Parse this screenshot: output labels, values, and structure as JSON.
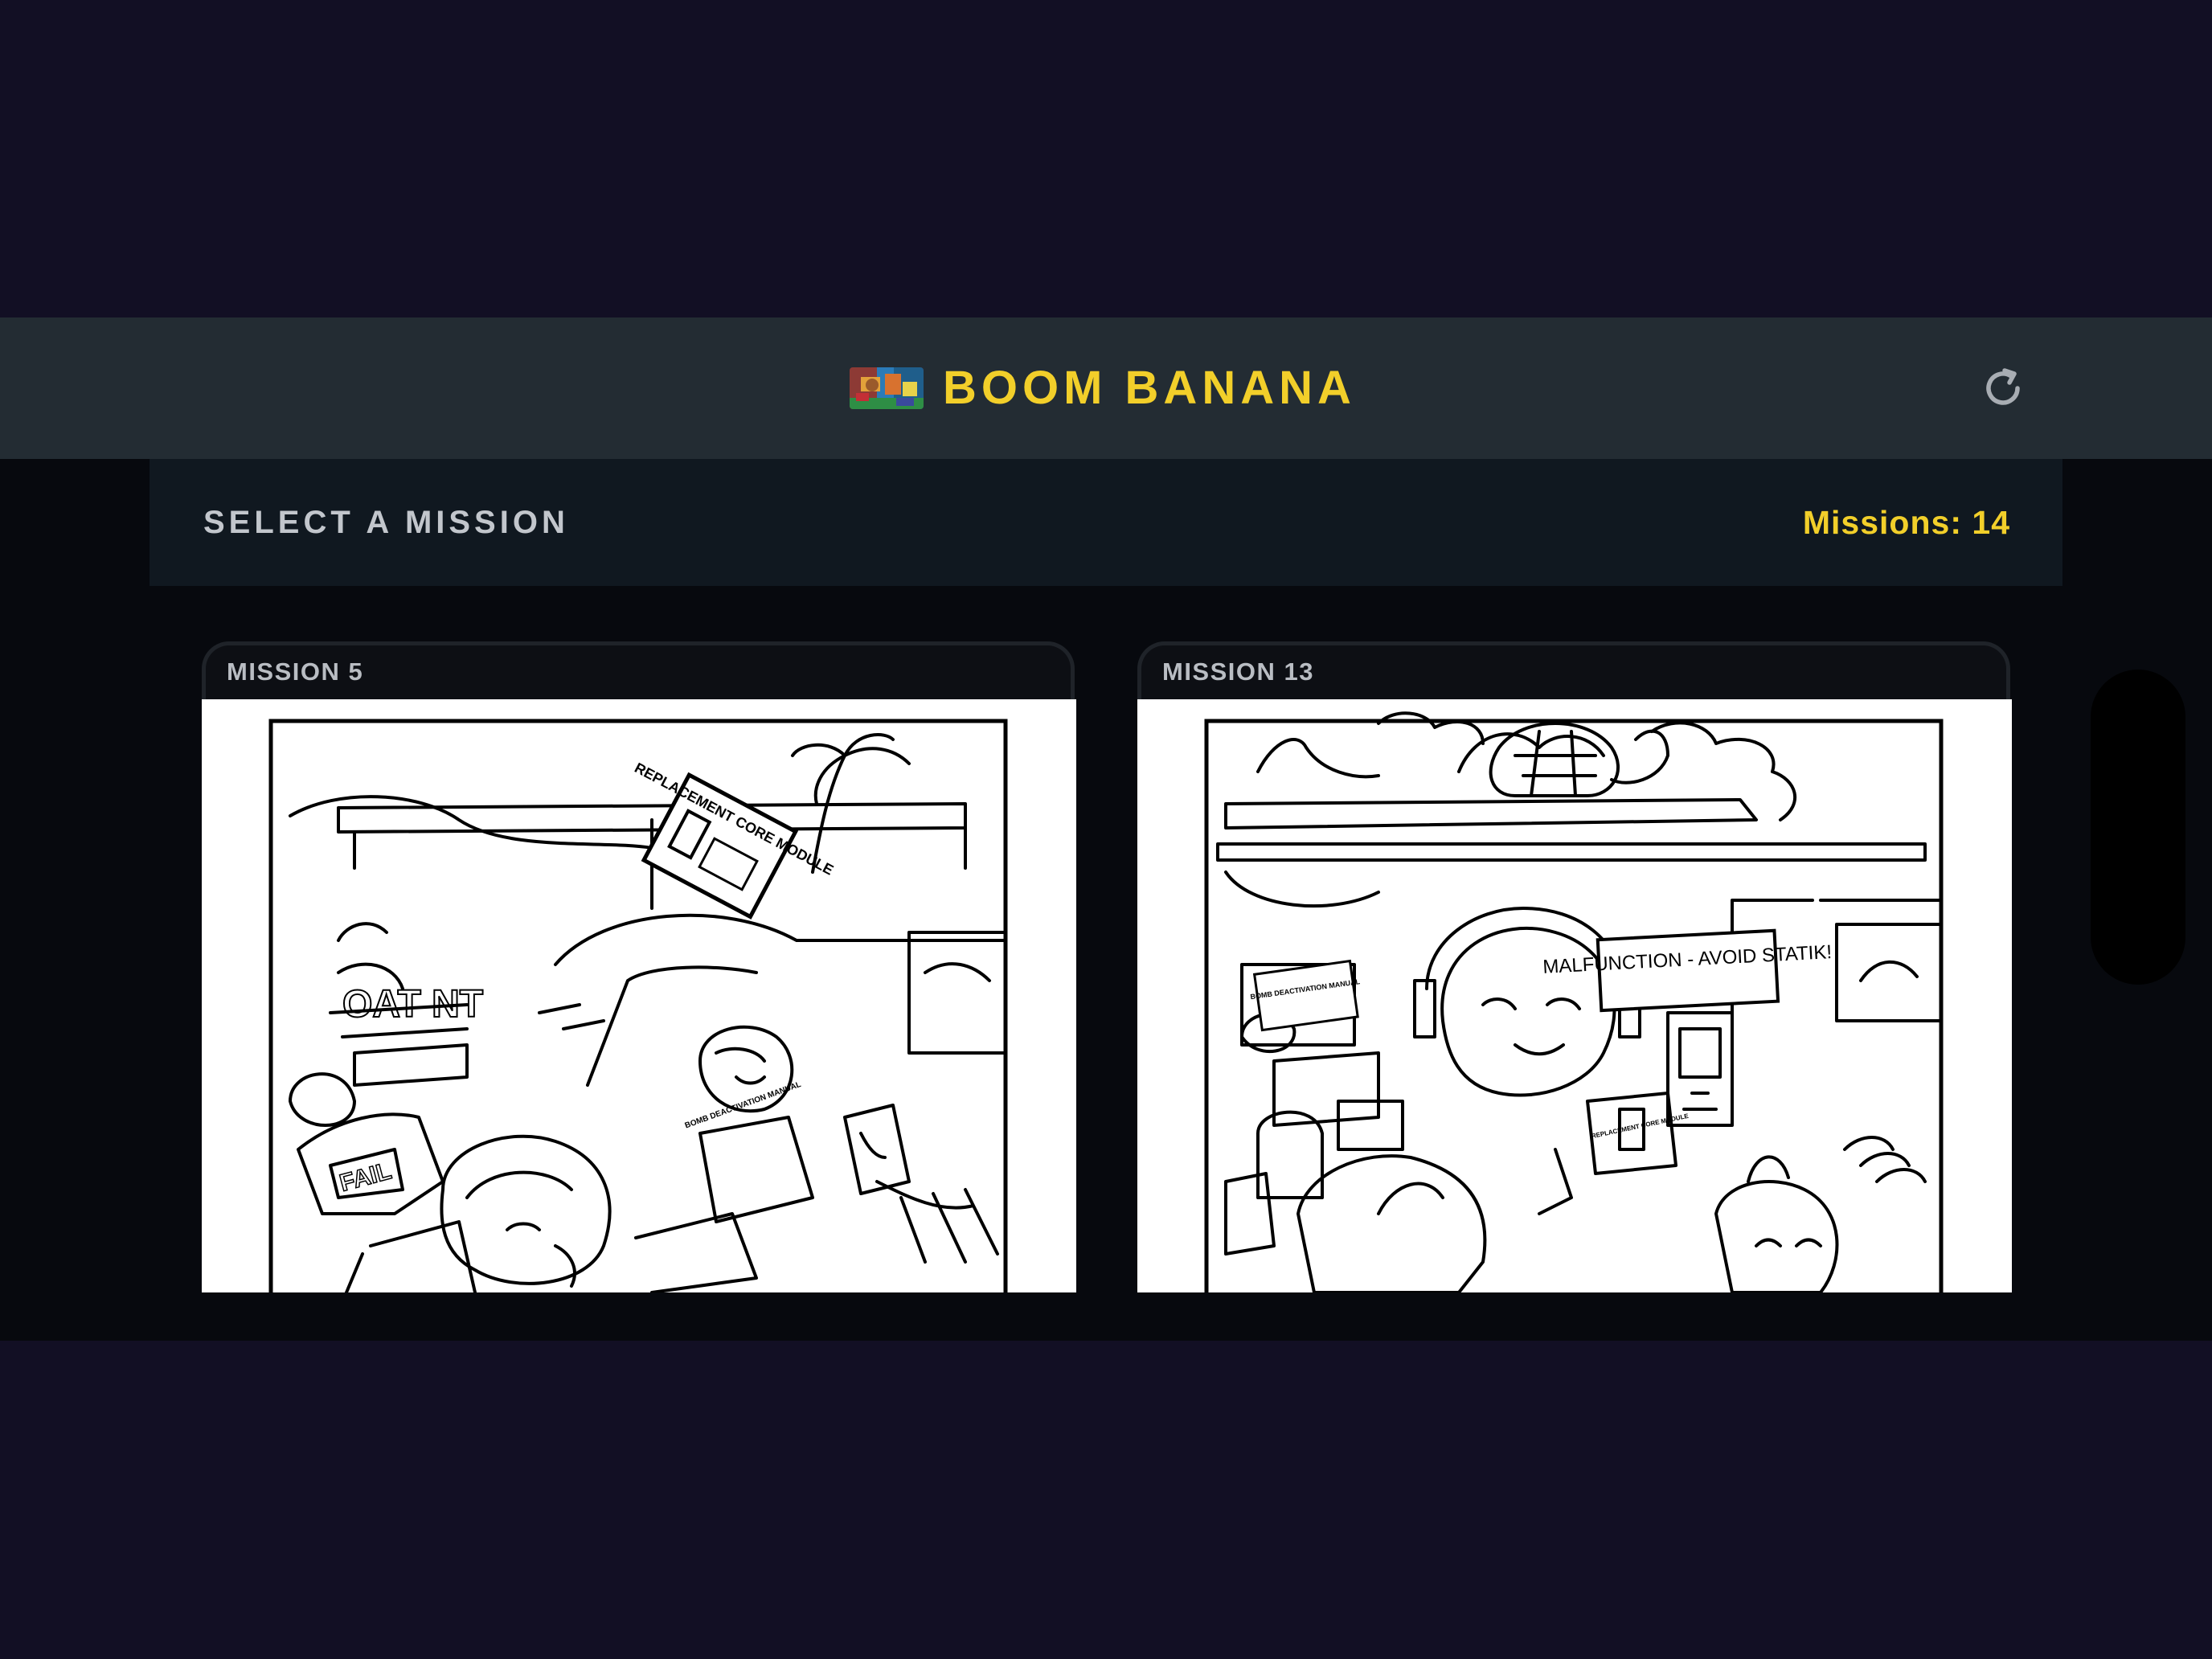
{
  "header": {
    "title": "BOOM BANANA",
    "logo_icon": "boom-banana-logo-icon",
    "refresh_icon": "refresh-icon"
  },
  "toolbar": {
    "label": "SELECT A MISSION",
    "count_label": "Missions:",
    "count_value": "14"
  },
  "missions": [
    {
      "label": "MISSION 5",
      "illustration": {
        "labels": [
          "REPLACEMENT CORE MODULE",
          "FAIL",
          "BOMB DEACTIVATION MANUAL"
        ]
      }
    },
    {
      "label": "MISSION 13",
      "illustration": {
        "labels": [
          "MALFUNCTION - AVOID STATIK!",
          "BOMB DEACTIVATION MANUAL",
          "REPLACEMENT CORE MODULE"
        ]
      }
    }
  ],
  "colors": {
    "outer_background": "#120f24",
    "app_background": "#07090e",
    "header_background": "#232c33",
    "toolbar_background": "#101820",
    "accent": "#f2cf2a",
    "muted_text": "#c2c6cc"
  }
}
